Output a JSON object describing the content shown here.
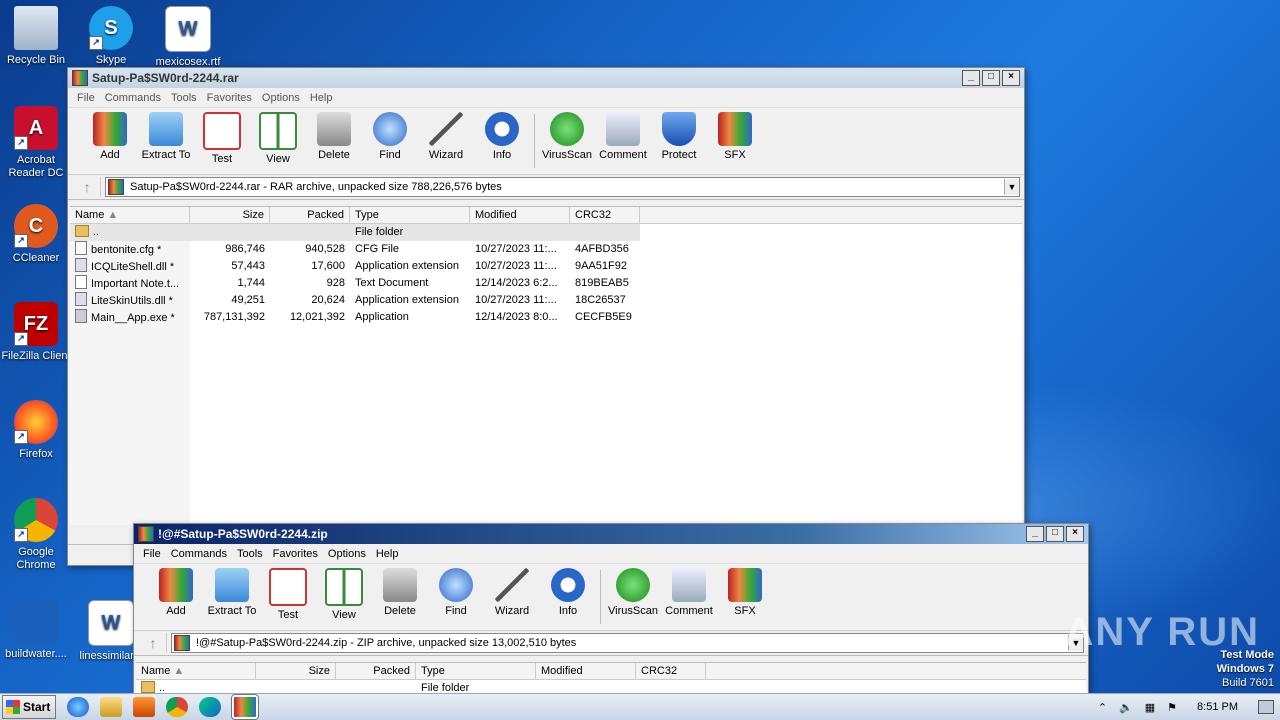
{
  "desktop": {
    "icons": [
      {
        "label": "Recycle Bin"
      },
      {
        "label": "Skype"
      },
      {
        "label": "mexicosex.rtf"
      },
      {
        "label": "Acrobat Reader DC"
      },
      {
        "label": "CCleaner"
      },
      {
        "label": "FileZilla Client"
      },
      {
        "label": "Firefox"
      },
      {
        "label": "Google Chrome"
      },
      {
        "label": "buildwater...."
      },
      {
        "label": "linessimilar..."
      }
    ],
    "watermark": "ANY RUN",
    "test_mode": [
      "Test Mode",
      "Windows 7",
      "Build 7601"
    ]
  },
  "rar_window": {
    "title": "Satup-Pa$SW0rd-2244.rar",
    "menu": [
      "File",
      "Commands",
      "Tools",
      "Favorites",
      "Options",
      "Help"
    ],
    "toolbar": [
      "Add",
      "Extract To",
      "Test",
      "View",
      "Delete",
      "Find",
      "Wizard",
      "Info",
      "VirusScan",
      "Comment",
      "Protect",
      "SFX"
    ],
    "address": "Satup-Pa$SW0rd-2244.rar - RAR archive, unpacked size 788,226,576 bytes",
    "columns": [
      "Name",
      "Size",
      "Packed",
      "Type",
      "Modified",
      "CRC32"
    ],
    "rows": [
      {
        "name": "..",
        "size": "",
        "packed": "",
        "type": "File folder",
        "modified": "",
        "crc": ""
      },
      {
        "name": "bentonite.cfg *",
        "size": "986,746",
        "packed": "940,528",
        "type": "CFG File",
        "modified": "10/27/2023 11:...",
        "crc": "4AFBD356"
      },
      {
        "name": "ICQLiteShell.dll *",
        "size": "57,443",
        "packed": "17,600",
        "type": "Application extension",
        "modified": "10/27/2023 11:...",
        "crc": "9AA51F92"
      },
      {
        "name": "Important Note.t...",
        "size": "1,744",
        "packed": "928",
        "type": "Text Document",
        "modified": "12/14/2023 6:2...",
        "crc": "819BEAB5"
      },
      {
        "name": "LiteSkinUtils.dll *",
        "size": "49,251",
        "packed": "20,624",
        "type": "Application extension",
        "modified": "10/27/2023 11:...",
        "crc": "18C26537"
      },
      {
        "name": "Main__App.exe *",
        "size": "787,131,392",
        "packed": "12,021,392",
        "type": "Application",
        "modified": "12/14/2023 8:0...",
        "crc": "CECFB5E9"
      }
    ]
  },
  "zip_window": {
    "title": "!@#Satup-Pa$SW0rd-2244.zip",
    "menu": [
      "File",
      "Commands",
      "Tools",
      "Favorites",
      "Options",
      "Help"
    ],
    "toolbar": [
      "Add",
      "Extract To",
      "Test",
      "View",
      "Delete",
      "Find",
      "Wizard",
      "Info",
      "VirusScan",
      "Comment",
      "SFX"
    ],
    "address": "!@#Satup-Pa$SW0rd-2244.zip - ZIP archive, unpacked size 13,002,510 bytes",
    "columns": [
      "Name",
      "Size",
      "Packed",
      "Type",
      "Modified",
      "CRC32"
    ],
    "rows": [
      {
        "name": "..",
        "type": "File folder"
      }
    ]
  },
  "taskbar": {
    "start": "Start",
    "clock": "8:51 PM"
  }
}
